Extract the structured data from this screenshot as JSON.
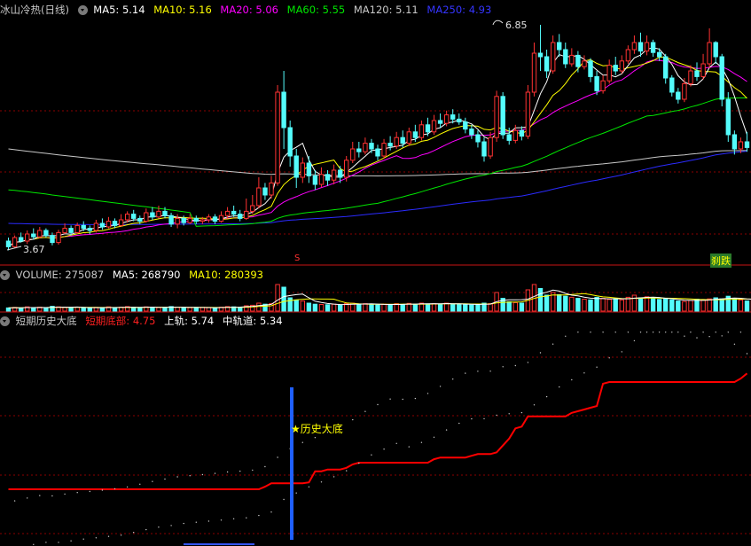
{
  "colors": {
    "up": "#ff3232",
    "down": "#54fcfc",
    "ma5": "#ffffff",
    "ma10": "#ffff00",
    "ma20": "#ff00ff",
    "ma60": "#00e600",
    "ma120": "#c8c8c8",
    "ma250": "#2b2bff",
    "grid": "#8b0000",
    "line": "#ff0000",
    "star": "#ffff00",
    "blue_bar": "#1f5fff"
  },
  "main": {
    "indicator": "冰山冷热(日线)",
    "ma5": {
      "label": "MA5:",
      "value": "5.14"
    },
    "ma10": {
      "label": "MA10:",
      "value": "5.16"
    },
    "ma20": {
      "label": "MA20:",
      "value": "5.06"
    },
    "ma60": {
      "label": "MA60:",
      "value": "5.55"
    },
    "ma120": {
      "label": "MA120:",
      "value": "5.11"
    },
    "ma250": {
      "label": "MA250:",
      "value": "4.93"
    },
    "high_label": "6.85",
    "low_label": "3.67",
    "signal_s": "S",
    "signal_text": "刹跌"
  },
  "volume": {
    "title": "VOLUME:",
    "value": "275087",
    "ma5_label": "MA5:",
    "ma5_value": "268790",
    "ma10_label": "MA10:",
    "ma10_value": "280393"
  },
  "bottom": {
    "title": "短期历史大底",
    "l1_label": "短期底部:",
    "l1_value": "4.75",
    "l2_label": "上轨:",
    "l2_value": "5.74",
    "l3_label": "中轨道:",
    "l3_value": "5.34",
    "star_text": "★历史大底"
  },
  "chart_data": [
    {
      "type": "candlestick",
      "title": "冰山冷热(日线)",
      "ylim": [
        3.5,
        7.0
      ],
      "annotations": {
        "high": 6.85,
        "low": 3.67
      },
      "series": [
        {
          "name": "MA5",
          "last": 5.14
        },
        {
          "name": "MA10",
          "last": 5.16
        },
        {
          "name": "MA20",
          "last": 5.06
        },
        {
          "name": "MA60",
          "last": 5.55
        },
        {
          "name": "MA120",
          "last": 5.11
        },
        {
          "name": "MA250",
          "last": 4.93
        }
      ],
      "candles": [
        [
          3.8,
          3.72,
          3.85,
          3.67
        ],
        [
          3.72,
          3.85,
          3.88,
          3.7
        ],
        [
          3.85,
          3.8,
          3.92,
          3.78
        ],
        [
          3.8,
          3.9,
          3.95,
          3.76
        ],
        [
          3.9,
          3.86,
          3.98,
          3.82
        ],
        [
          3.86,
          3.95,
          4.0,
          3.84
        ],
        [
          3.95,
          3.88,
          3.98,
          3.85
        ],
        [
          3.88,
          3.78,
          3.92,
          3.74
        ],
        [
          3.78,
          3.92,
          3.96,
          3.75
        ],
        [
          3.92,
          3.98,
          4.05,
          3.9
        ],
        [
          3.98,
          3.92,
          4.02,
          3.88
        ],
        [
          3.92,
          4.02,
          4.06,
          3.9
        ],
        [
          4.02,
          3.98,
          4.08,
          3.94
        ],
        [
          3.98,
          3.95,
          4.02,
          3.9
        ],
        [
          3.95,
          4.05,
          4.1,
          3.92
        ],
        [
          4.05,
          4.0,
          4.12,
          3.96
        ],
        [
          4.0,
          4.08,
          4.14,
          3.98
        ],
        [
          4.08,
          4.02,
          4.12,
          3.98
        ],
        [
          4.02,
          4.1,
          4.18,
          4.0
        ],
        [
          4.1,
          4.18,
          4.22,
          4.06
        ],
        [
          4.18,
          4.12,
          4.24,
          4.08
        ],
        [
          4.12,
          4.08,
          4.16,
          4.04
        ],
        [
          4.08,
          4.2,
          4.26,
          4.06
        ],
        [
          4.2,
          4.14,
          4.28,
          4.1
        ],
        [
          4.14,
          4.22,
          4.3,
          4.12
        ],
        [
          4.22,
          4.16,
          4.28,
          4.12
        ],
        [
          4.16,
          4.04,
          4.2,
          4.0
        ],
        [
          4.04,
          4.12,
          4.18,
          3.98
        ],
        [
          4.12,
          4.06,
          4.16,
          4.02
        ],
        [
          4.06,
          4.12,
          4.18,
          4.04
        ],
        [
          4.12,
          4.08,
          4.16,
          4.04
        ],
        [
          4.08,
          4.1,
          4.14,
          4.04
        ],
        [
          4.1,
          4.14,
          4.18,
          4.06
        ],
        [
          4.14,
          4.08,
          4.18,
          4.04
        ],
        [
          4.08,
          4.16,
          4.22,
          4.06
        ],
        [
          4.16,
          4.22,
          4.28,
          4.12
        ],
        [
          4.22,
          4.18,
          4.3,
          4.14
        ],
        [
          4.18,
          4.12,
          4.24,
          4.08
        ],
        [
          4.12,
          4.22,
          4.4,
          4.1
        ],
        [
          4.22,
          4.3,
          4.45,
          4.18
        ],
        [
          4.3,
          4.55,
          4.7,
          4.26
        ],
        [
          4.55,
          4.45,
          4.62,
          4.38
        ],
        [
          4.45,
          4.62,
          4.72,
          4.4
        ],
        [
          4.62,
          5.9,
          6.0,
          4.58
        ],
        [
          5.9,
          5.4,
          6.2,
          5.1
        ],
        [
          5.4,
          5.0,
          5.5,
          4.85
        ],
        [
          5.0,
          4.7,
          5.1,
          4.55
        ],
        [
          4.7,
          4.9,
          4.98,
          4.62
        ],
        [
          4.9,
          4.72,
          5.0,
          4.62
        ],
        [
          4.72,
          4.6,
          4.8,
          4.52
        ],
        [
          4.6,
          4.74,
          4.84,
          4.56
        ],
        [
          4.74,
          4.66,
          4.8,
          4.58
        ],
        [
          4.66,
          4.8,
          4.88,
          4.6
        ],
        [
          4.8,
          4.7,
          4.86,
          4.62
        ],
        [
          4.7,
          4.94,
          5.0,
          4.64
        ],
        [
          4.94,
          5.1,
          5.2,
          4.9
        ],
        [
          5.1,
          5.06,
          5.2,
          4.98
        ],
        [
          5.06,
          5.18,
          5.26,
          5.02
        ],
        [
          5.18,
          5.1,
          5.24,
          5.04
        ],
        [
          5.1,
          5.0,
          5.16,
          4.94
        ],
        [
          5.0,
          5.18,
          5.24,
          4.96
        ],
        [
          5.18,
          5.14,
          5.28,
          5.08
        ],
        [
          5.14,
          5.26,
          5.34,
          5.1
        ],
        [
          5.26,
          5.18,
          5.36,
          5.12
        ],
        [
          5.18,
          5.34,
          5.4,
          5.14
        ],
        [
          5.34,
          5.26,
          5.44,
          5.2
        ],
        [
          5.26,
          5.44,
          5.5,
          5.22
        ],
        [
          5.44,
          5.34,
          5.54,
          5.28
        ],
        [
          5.34,
          5.5,
          5.58,
          5.3
        ],
        [
          5.5,
          5.46,
          5.6,
          5.4
        ],
        [
          5.46,
          5.58,
          5.64,
          5.42
        ],
        [
          5.58,
          5.52,
          5.66,
          5.46
        ],
        [
          5.52,
          5.48,
          5.6,
          5.44
        ],
        [
          5.48,
          5.38,
          5.54,
          5.32
        ],
        [
          5.38,
          5.3,
          5.44,
          5.24
        ],
        [
          5.3,
          5.2,
          5.36,
          5.12
        ],
        [
          5.2,
          5.0,
          5.26,
          4.92
        ],
        [
          5.0,
          5.26,
          5.34,
          4.96
        ],
        [
          5.26,
          5.84,
          5.92,
          5.2
        ],
        [
          5.84,
          5.3,
          5.9,
          5.24
        ],
        [
          5.3,
          5.22,
          5.4,
          5.16
        ],
        [
          5.22,
          5.36,
          5.44,
          5.18
        ],
        [
          5.36,
          5.28,
          5.42,
          5.22
        ],
        [
          5.28,
          5.9,
          6.0,
          5.24
        ],
        [
          5.9,
          6.45,
          6.6,
          5.84
        ],
        [
          6.45,
          6.4,
          6.85,
          6.2
        ],
        [
          6.4,
          6.2,
          6.5,
          6.1
        ],
        [
          6.2,
          6.6,
          6.7,
          6.16
        ],
        [
          6.6,
          6.5,
          6.72,
          6.4
        ],
        [
          6.5,
          6.3,
          6.6,
          6.24
        ],
        [
          6.3,
          6.42,
          6.52,
          6.26
        ],
        [
          6.42,
          6.26,
          6.48,
          6.18
        ],
        [
          6.26,
          6.34,
          6.42,
          6.22
        ],
        [
          6.34,
          6.12,
          6.38,
          6.04
        ],
        [
          6.12,
          5.92,
          6.2,
          5.86
        ],
        [
          5.92,
          6.06,
          6.14,
          5.88
        ],
        [
          6.06,
          6.28,
          6.36,
          6.02
        ],
        [
          6.28,
          6.2,
          6.4,
          6.14
        ],
        [
          6.2,
          6.34,
          6.42,
          6.16
        ],
        [
          6.34,
          6.5,
          6.56,
          6.3
        ],
        [
          6.5,
          6.6,
          6.7,
          6.44
        ],
        [
          6.6,
          6.48,
          6.74,
          6.4
        ],
        [
          6.48,
          6.6,
          6.7,
          6.42
        ],
        [
          6.6,
          6.46,
          6.64,
          6.4
        ],
        [
          6.46,
          6.4,
          6.52,
          6.34
        ],
        [
          6.4,
          6.1,
          6.44,
          6.02
        ],
        [
          6.1,
          5.9,
          6.14,
          5.84
        ],
        [
          5.9,
          5.8,
          5.96,
          5.74
        ],
        [
          5.8,
          6.02,
          6.1,
          5.76
        ],
        [
          6.02,
          6.2,
          6.28,
          5.98
        ],
        [
          6.2,
          6.12,
          6.32,
          6.06
        ],
        [
          6.12,
          6.3,
          6.44,
          6.08
        ],
        [
          6.3,
          6.6,
          6.8,
          6.24
        ],
        [
          6.6,
          6.4,
          6.62,
          6.3
        ],
        [
          6.4,
          5.8,
          6.44,
          5.7
        ],
        [
          5.8,
          5.3,
          5.9,
          5.2
        ],
        [
          5.3,
          5.1,
          5.36,
          5.02
        ],
        [
          5.1,
          5.2,
          5.26,
          5.04
        ],
        [
          5.2,
          5.12,
          5.34,
          5.06
        ]
      ]
    },
    {
      "type": "bar",
      "title": "VOLUME",
      "series": [
        {
          "name": "VOLUME",
          "last": 275087
        },
        {
          "name": "MA5",
          "last": 268790
        },
        {
          "name": "MA10",
          "last": 280393
        }
      ],
      "ylim": [
        0,
        1100000
      ],
      "values": [
        120000,
        140000,
        110000,
        160000,
        130000,
        150000,
        120000,
        180000,
        160000,
        140000,
        130000,
        150000,
        120000,
        110000,
        140000,
        130000,
        160000,
        120000,
        150000,
        170000,
        140000,
        130000,
        160000,
        150000,
        140000,
        130000,
        170000,
        150000,
        140000,
        130000,
        120000,
        140000,
        130000,
        120000,
        150000,
        170000,
        160000,
        150000,
        200000,
        220000,
        300000,
        260000,
        280000,
        1000000,
        900000,
        500000,
        420000,
        380000,
        300000,
        260000,
        250000,
        240000,
        260000,
        220000,
        280000,
        300000,
        260000,
        280000,
        240000,
        230000,
        260000,
        240000,
        280000,
        250000,
        290000,
        260000,
        300000,
        270000,
        280000,
        260000,
        300000,
        270000,
        250000,
        240000,
        230000,
        260000,
        300000,
        280000,
        700000,
        480000,
        350000,
        320000,
        300000,
        800000,
        1000000,
        850000,
        600000,
        700000,
        620000,
        560000,
        520000,
        480000,
        450000,
        420000,
        520000,
        480000,
        440000,
        460000,
        420000,
        520000,
        600000,
        500000,
        540000,
        480000,
        440000,
        460000,
        420000,
        380000,
        360000,
        400000,
        450000,
        420000,
        460000,
        500000,
        460000,
        560000,
        480000,
        420000,
        380000,
        400000,
        275087
      ]
    },
    {
      "type": "line",
      "title": "短期历史大底",
      "series": [
        {
          "name": "短期底部",
          "last": 4.75
        },
        {
          "name": "上轨",
          "last": 5.74
        },
        {
          "name": "中轨道",
          "last": 5.34
        }
      ],
      "annotations": [
        "★历史大底"
      ],
      "ylim": [
        4.0,
        6.5
      ]
    }
  ]
}
